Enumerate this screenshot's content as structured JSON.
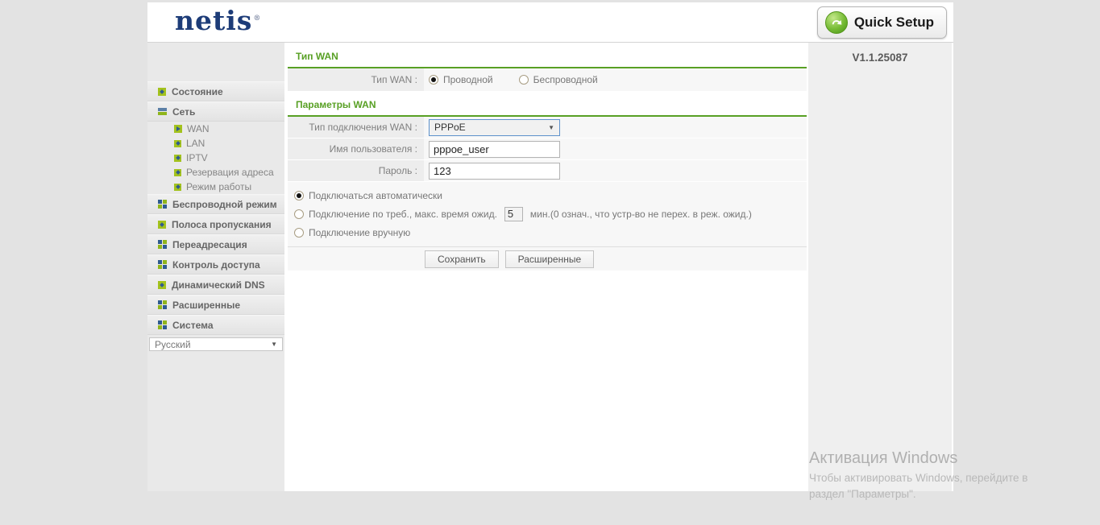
{
  "colors": {
    "accent_green": "#58a024",
    "logo_navy": "#1d3c78",
    "icon_green": "#a3c21d",
    "icon_blue": "#2f5b90"
  },
  "header": {
    "logo_text": "netis",
    "logo_mark": "®",
    "quick_setup_label": "Quick Setup"
  },
  "sidebar": {
    "items": [
      {
        "label": "Состояние"
      },
      {
        "label": "Сеть",
        "children": [
          {
            "label": "WAN",
            "active": true
          },
          {
            "label": "LAN"
          },
          {
            "label": "IPTV"
          },
          {
            "label": "Резервация адреса"
          },
          {
            "label": "Режим работы"
          }
        ]
      },
      {
        "label": "Беспроводной режим"
      },
      {
        "label": "Полоса пропускания"
      },
      {
        "label": "Переадресация"
      },
      {
        "label": "Контроль доступа"
      },
      {
        "label": "Динамический DNS"
      },
      {
        "label": "Расширенные"
      },
      {
        "label": "Система"
      }
    ],
    "language_select": {
      "value": "Русский"
    }
  },
  "content": {
    "wan_type_section": {
      "title": "Тип WAN",
      "label": "Тип WAN :",
      "options": {
        "wired": "Проводной",
        "wireless": "Беспроводной"
      },
      "selected": "Проводной"
    },
    "wan_params_section": {
      "title": "Параметры WAN",
      "connection_type_label": "Тип подключения WAN :",
      "connection_type_value": "PPPoE",
      "username_label": "Имя пользователя :",
      "username_value": "pppoe_user",
      "password_label": "Пароль :",
      "password_value": "123",
      "connect_options": {
        "auto": "Подключаться автоматически",
        "on_demand_prefix": "Подключение по треб., макс. время ожид.",
        "on_demand_minutes": "5",
        "on_demand_suffix": "мин.(0 означ., что устр-во не перех. в реж. ожид.)",
        "manual": "Подключение вручную",
        "selected": "Подключаться автоматически"
      },
      "buttons": {
        "save": "Сохранить",
        "advanced": "Расширенные"
      }
    }
  },
  "right_panel": {
    "version": "V1.1.25087"
  },
  "watermark": {
    "title": "Активация Windows",
    "line1": "Чтобы активировать Windows, перейдите в",
    "line2": "раздел \"Параметры\"."
  }
}
